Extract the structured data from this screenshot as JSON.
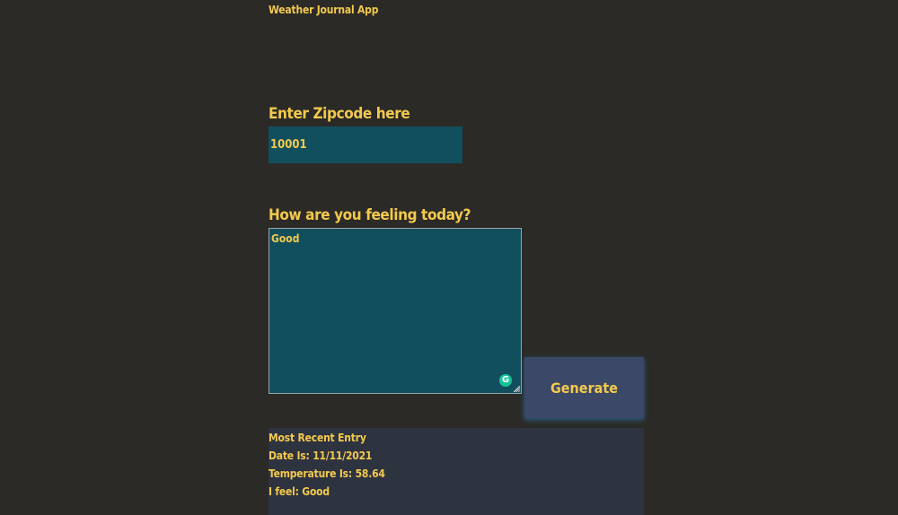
{
  "app": {
    "title": "Weather Journal App"
  },
  "zip": {
    "label": "Enter Zipcode here",
    "value": "10001"
  },
  "feelings": {
    "label": "How are you feeling today?",
    "value": "Good"
  },
  "icons": {
    "grammarly": "grammarly-icon",
    "resize": "resize-handle-icon"
  },
  "generate": {
    "label": "Generate"
  },
  "entry": {
    "heading": "Most Recent Entry",
    "date": "Date Is: 11/11/2021",
    "temp": "Temperature Is: 58.64",
    "content": "I feel: Good"
  },
  "colors": {
    "background": "#2b2a26",
    "text": "#f2c94c",
    "input_bg": "#124f5e",
    "button_bg": "#3b4867",
    "entry_bg": "#2e3340"
  }
}
